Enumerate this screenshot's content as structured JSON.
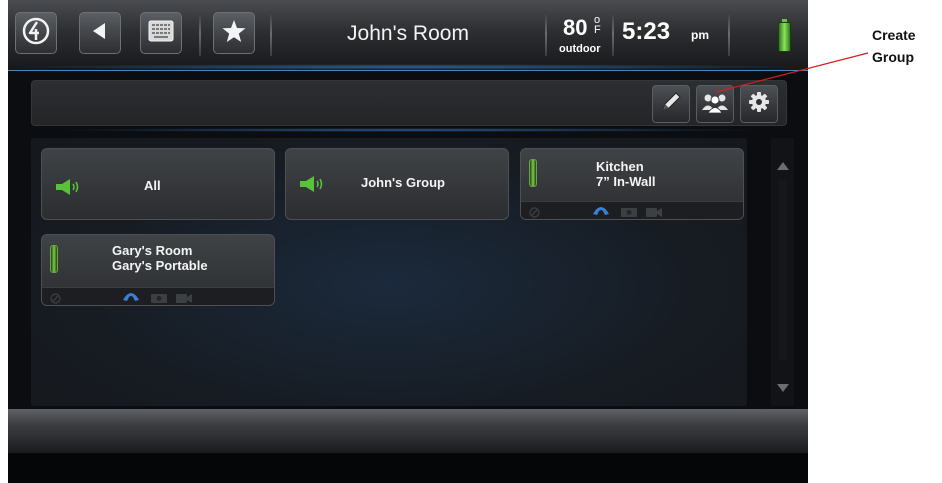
{
  "topbar": {
    "title": "John's Room",
    "temperature": "80",
    "temperature_unit_top": "o",
    "temperature_unit_bottom": "F",
    "temperature_label": "outdoor",
    "time": "5:23",
    "time_suffix": "pm",
    "buttons": [
      {
        "icon": "home-logo-icon"
      },
      {
        "icon": "back-arrow-icon"
      },
      {
        "icon": "keypad-icon"
      },
      {
        "icon": "star-icon"
      }
    ],
    "battery_color": "#6fcf3e"
  },
  "toolbar": {
    "buttons": [
      {
        "icon": "pencil-icon"
      },
      {
        "icon": "group-people-icon"
      },
      {
        "icon": "gear-icon"
      }
    ]
  },
  "rooms": [
    {
      "label": "All",
      "icon": "speaker-icon"
    },
    {
      "label": "John's Group",
      "icon": "speaker-icon"
    },
    {
      "line1": "Kitchen",
      "line2": "7” In-Wall",
      "icons": [
        "do-not-disturb-icon",
        "phone-icon",
        "camera-icon",
        "video-icon"
      ]
    },
    {
      "line1": "Gary's Room",
      "line2": "Gary's Portable",
      "icons": [
        "do-not-disturb-icon",
        "phone-icon",
        "camera-icon",
        "video-icon"
      ]
    }
  ],
  "callout": {
    "line1": "Create",
    "line2": "Group",
    "color": "#d21f1f"
  },
  "colors": {
    "accent_blue": "#4a86b8",
    "speaker_green": "#58c23a",
    "phone_blue": "#3e7fd6"
  }
}
